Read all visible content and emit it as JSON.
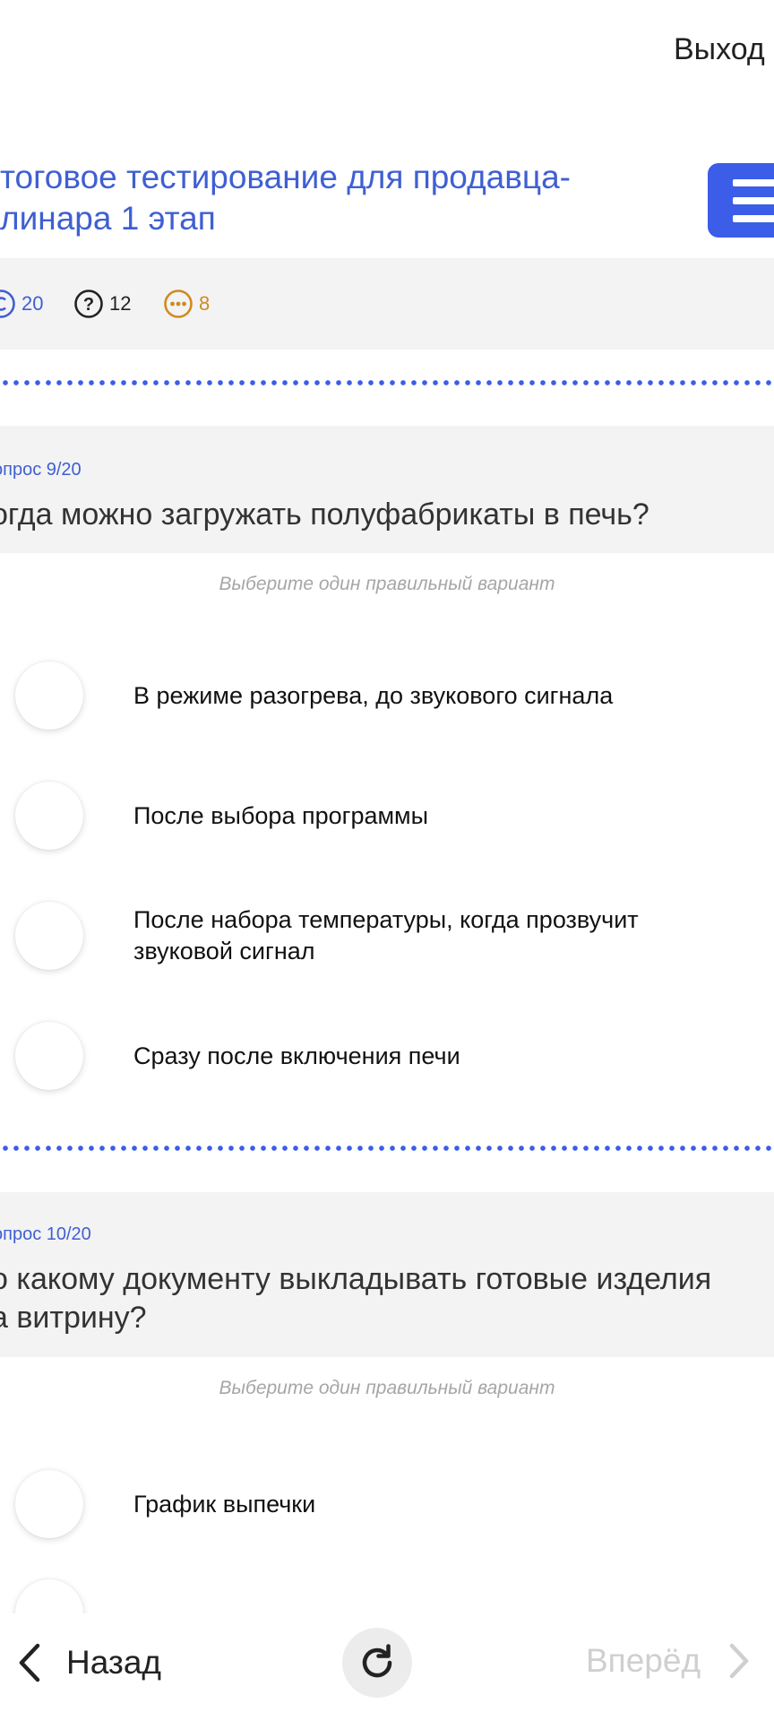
{
  "header": {
    "exit_label": "Выход",
    "test_title": "тоговое тестирование для продавца-\nлинара 1 этап"
  },
  "stats": {
    "total_questions": "20",
    "unanswered": "12",
    "skipped": "8"
  },
  "questions": [
    {
      "number": "опрос 9/20",
      "text": "огда можно загружать полуфабрикаты в печь?",
      "hint": "Выберите один правильный вариант",
      "options": [
        {
          "label": "В режиме разогрева, до звукового сигнала",
          "selected": false
        },
        {
          "label": "После выбора программы",
          "selected": false
        },
        {
          "label": "После набора температуры, когда прозвучит\nзвуковой сигнал",
          "selected": false
        },
        {
          "label": "Сразу после включения печи",
          "selected": false
        }
      ]
    },
    {
      "number": "опрос 10/20",
      "text": "о какому документу выкладывать готовые изделия\nа витрину?",
      "hint": "Выберите один правильный вариант",
      "options": [
        {
          "label": "График выпечки",
          "selected": false
        }
      ]
    }
  ],
  "navigation": {
    "back_label": "Назад",
    "forward_label": "Вперёд"
  },
  "colors": {
    "accent": "#3b5de8",
    "title_blue": "#3f5fd2",
    "skipped_orange": "#d08a1f",
    "panel_gray": "#f3f3f3"
  }
}
